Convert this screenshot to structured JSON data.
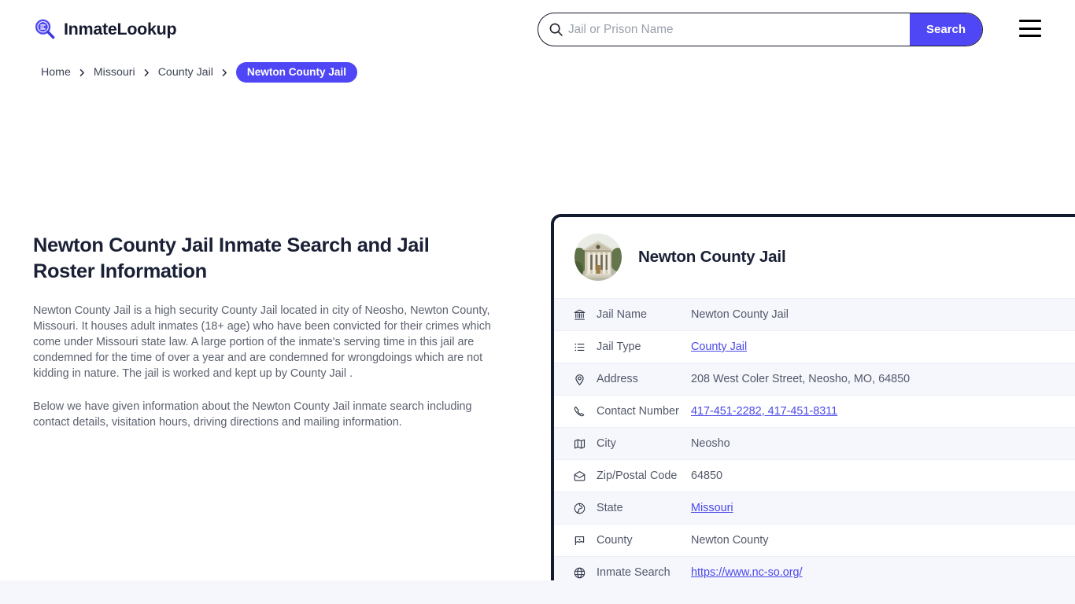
{
  "brand": {
    "name": "InmateLookup",
    "logo_icon": "magnifier-list-icon",
    "accent_color": "#4f46f5"
  },
  "search": {
    "placeholder": "Jail or Prison Name",
    "value": "",
    "button_label": "Search",
    "icon": "search-icon"
  },
  "menu": {
    "icon": "hamburger-menu-icon"
  },
  "breadcrumb": {
    "items": [
      {
        "label": "Home",
        "current": false
      },
      {
        "label": "Missouri",
        "current": false
      },
      {
        "label": "County Jail",
        "current": false
      },
      {
        "label": "Newton County Jail",
        "current": true
      }
    ],
    "separator_icon": "chevron-right-icon"
  },
  "main": {
    "title": "Newton County Jail Inmate Search and Jail Roster Information",
    "paragraphs": [
      "Newton County Jail is a high security County Jail located in city of Neosho, Newton County, Missouri. It houses adult inmates (18+ age) who have been convicted for their crimes which come under Missouri state law. A large portion of the inmate's serving time in this jail are condemned for the time of over a year and are condemned for wrongdoings which are not kidding in nature. The jail is worked and kept up by County Jail .",
      "Below we have given information about the Newton County Jail inmate search including contact details, visitation hours, driving directions and mailing information."
    ]
  },
  "info_card": {
    "header_title": "Newton County Jail",
    "avatar_icon": "courthouse-photo-thumbnail",
    "rows": [
      {
        "icon": "bank-courthouse-icon",
        "label": "Jail Name",
        "value": "Newton County Jail",
        "link": false
      },
      {
        "icon": "list-icon",
        "label": "Jail Type",
        "value": "County Jail",
        "link": true
      },
      {
        "icon": "map-pin-icon",
        "label": "Address",
        "value": "208 West Coler Street, Neosho, MO, 64850",
        "link": false
      },
      {
        "icon": "phone-icon",
        "label": "Contact Number",
        "value": "417-451-2282, 417-451-8311",
        "link": true
      },
      {
        "icon": "map-icon",
        "label": "City",
        "value": "Neosho",
        "link": false
      },
      {
        "icon": "mail-open-icon",
        "label": "Zip/Postal Code",
        "value": "64850",
        "link": false
      },
      {
        "icon": "globe-americas-icon",
        "label": "State",
        "value": "Missouri",
        "link": true
      },
      {
        "icon": "flag-pin-icon",
        "label": "County",
        "value": "Newton County",
        "link": false
      },
      {
        "icon": "globe-icon",
        "label": "Inmate Search",
        "value": "https://www.nc-so.org/",
        "link": true
      }
    ]
  }
}
